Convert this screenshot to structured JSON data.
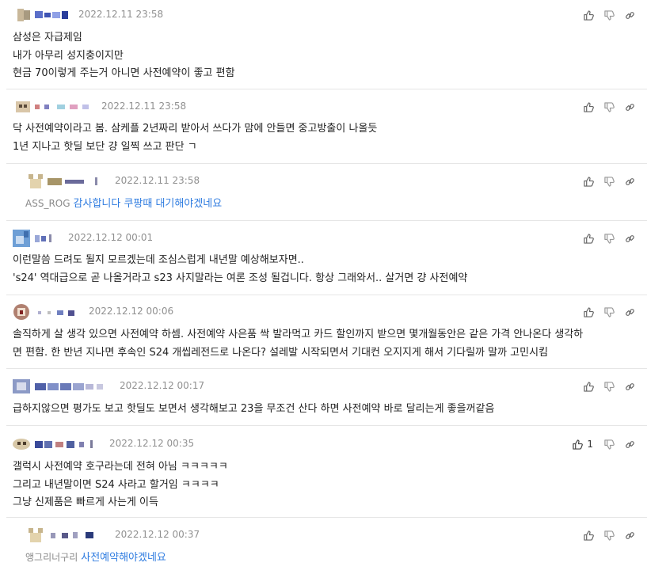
{
  "comments": [
    {
      "date": "2022.12.11 23:58",
      "lines": [
        "삼성은 자급제임",
        "내가 아무리 성지충이지만",
        "현금 70이렇게 주는거 아니면 사전예약이 좋고 편함"
      ]
    },
    {
      "date": "2022.12.11 23:58",
      "lines": [
        "닥 사전예약이라고 봄. 삼케플 2년짜리 받아서 쓰다가 맘에 안들면 중고방출이 나올듯",
        "1년 지나고 핫딜 보단 걍 일찍 쓰고 판단 ㄱ"
      ]
    },
    {
      "date": "2022.12.11 23:58",
      "mention": "ASS_ROG",
      "text": "감사합니다 쿠팡때 대기해야겠네요"
    },
    {
      "date": "2022.12.12 00:01",
      "lines": [
        "이런말씀 드려도 될지 모르겠는데 조심스럽게 내년말 예상해보자면..",
        "'s24' 역대급으로 곧 나올거라고 s23 사지말라는 여론 조성 될겁니다. 항상 그래와서.. 살거면 걍 사전예약"
      ]
    },
    {
      "date": "2022.12.12 00:06",
      "lines": [
        "솔직하게 살 생각 있으면 사전예약 하셈. 사전예약 사은품 싹 발라먹고 카드 할인까지 받으면 몇개월동안은 같은 가격 안나온다 생각하",
        "면 편함. 한 반년 지나면 후속인 S24 개씹레전드로 나온다? 설레발 시작되면서 기대컨 오지지게 해서 기다릴까 말까 고민시킴"
      ]
    },
    {
      "date": "2022.12.12 00:17",
      "lines": [
        "급하지않으면 평가도 보고 핫딜도 보면서 생각해보고 23을 무조건 산다 하면 사전예약 바로 달리는게 좋을꺼같음"
      ]
    },
    {
      "date": "2022.12.12 00:35",
      "likes": "1",
      "lines": [
        "갤럭시 사전예약 호구라는데 전혀 아님 ㅋㅋㅋㅋㅋ",
        "그리고 내년말이면 S24 사라고 할거임 ㅋㅋㅋㅋ",
        "그냥 신제품은 빠르게 사는게 이득"
      ]
    },
    {
      "date": "2022.12.12 00:37",
      "mention": "앵그리너구리",
      "text": "사전예약해야겠네요"
    }
  ]
}
